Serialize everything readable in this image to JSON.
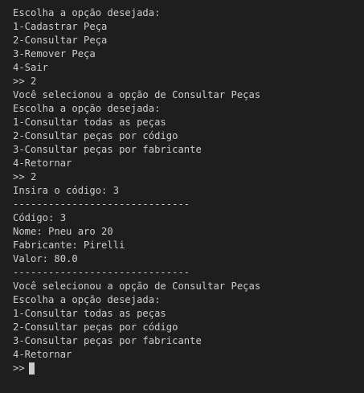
{
  "terminal": {
    "lines": [
      "Escolha a opção desejada:",
      "1-Cadastrar Peça",
      "2-Consultar Peça",
      "3-Remover Peça",
      "4-Sair",
      ">> 2",
      "Você selecionou a opção de Consultar Peças",
      "Escolha a opção desejada:",
      "1-Consultar todas as peças",
      "2-Consultar peças por código",
      "3-Consultar peças por fabricante",
      "4-Retornar",
      ">> 2",
      "Insira o código: 3",
      "------------------------------",
      "Código: 3",
      "Nome: Pneu aro 20",
      "Fabricante: Pirelli",
      "Valor: 80.0",
      "------------------------------",
      "Você selecionou a opção de Consultar Peças",
      "Escolha a opção desejada:",
      "1-Consultar todas as peças",
      "2-Consultar peças por código",
      "3-Consultar peças por fabricante",
      "4-Retornar"
    ],
    "prompt": ">>"
  },
  "colors": {
    "background": "#1e1e1e",
    "text": "#cccccc"
  }
}
